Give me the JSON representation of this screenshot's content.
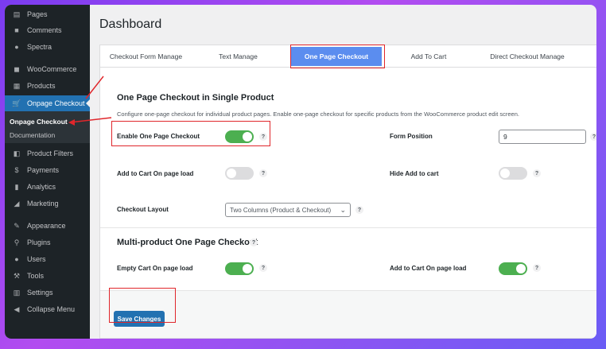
{
  "sidebar": {
    "items": [
      {
        "label": "Pages",
        "icon": "pages-icon"
      },
      {
        "label": "Comments",
        "icon": "comments-icon"
      },
      {
        "label": "Spectra",
        "icon": "spectra-icon"
      },
      {
        "label": "WooCommerce",
        "icon": "woocommerce-icon"
      },
      {
        "label": "Products",
        "icon": "products-icon"
      },
      {
        "label": "Onpage Checkout",
        "icon": "cart-icon"
      },
      {
        "label": "Product Filters",
        "icon": "filter-icon"
      },
      {
        "label": "Payments",
        "icon": "payments-icon"
      },
      {
        "label": "Analytics",
        "icon": "analytics-icon"
      },
      {
        "label": "Marketing",
        "icon": "marketing-icon"
      },
      {
        "label": "Appearance",
        "icon": "appearance-icon"
      },
      {
        "label": "Plugins",
        "icon": "plugins-icon"
      },
      {
        "label": "Users",
        "icon": "users-icon"
      },
      {
        "label": "Tools",
        "icon": "tools-icon"
      },
      {
        "label": "Settings",
        "icon": "settings-icon"
      },
      {
        "label": "Collapse Menu",
        "icon": "collapse-icon"
      }
    ],
    "submenu": [
      "Onpage Checkout",
      "Documentation"
    ]
  },
  "page": {
    "title": "Dashboard"
  },
  "tabs": [
    {
      "label": "Checkout Form Manage"
    },
    {
      "label": "Text Manage"
    },
    {
      "label": "One Page Checkout"
    },
    {
      "label": "Add To Cart"
    },
    {
      "label": "Direct Checkout Manage"
    }
  ],
  "section1": {
    "title": "One Page Checkout in Single Product",
    "description": "Configure one-page checkout for individual product pages. Enable one-page checkout for specific products from the WooCommerce product edit screen.",
    "enable_label": "Enable One Page Checkout",
    "form_position_label": "Form Position",
    "form_position_value": "9",
    "add_to_cart_label": "Add to Cart On page load",
    "hide_add_to_cart_label": "Hide Add to cart",
    "layout_label": "Checkout Layout",
    "layout_value": "Two Columns (Product & Checkout)"
  },
  "section2": {
    "title": "Multi-product One Page Checkout",
    "empty_cart_label": "Empty Cart On page load",
    "add_to_cart_label": "Add to Cart On page load"
  },
  "save_label": "Save Changes",
  "help_glyph": "?",
  "toggles": {
    "enable_one_page_checkout": true,
    "add_to_cart_on_load": false,
    "hide_add_to_cart": false,
    "empty_cart_on_load": true,
    "multi_add_to_cart_on_load": true
  },
  "colors": {
    "accent": "#2271b1",
    "tab_selected": "#5b8def",
    "toggle_on": "#4caf50",
    "highlight": "#e0262b"
  }
}
